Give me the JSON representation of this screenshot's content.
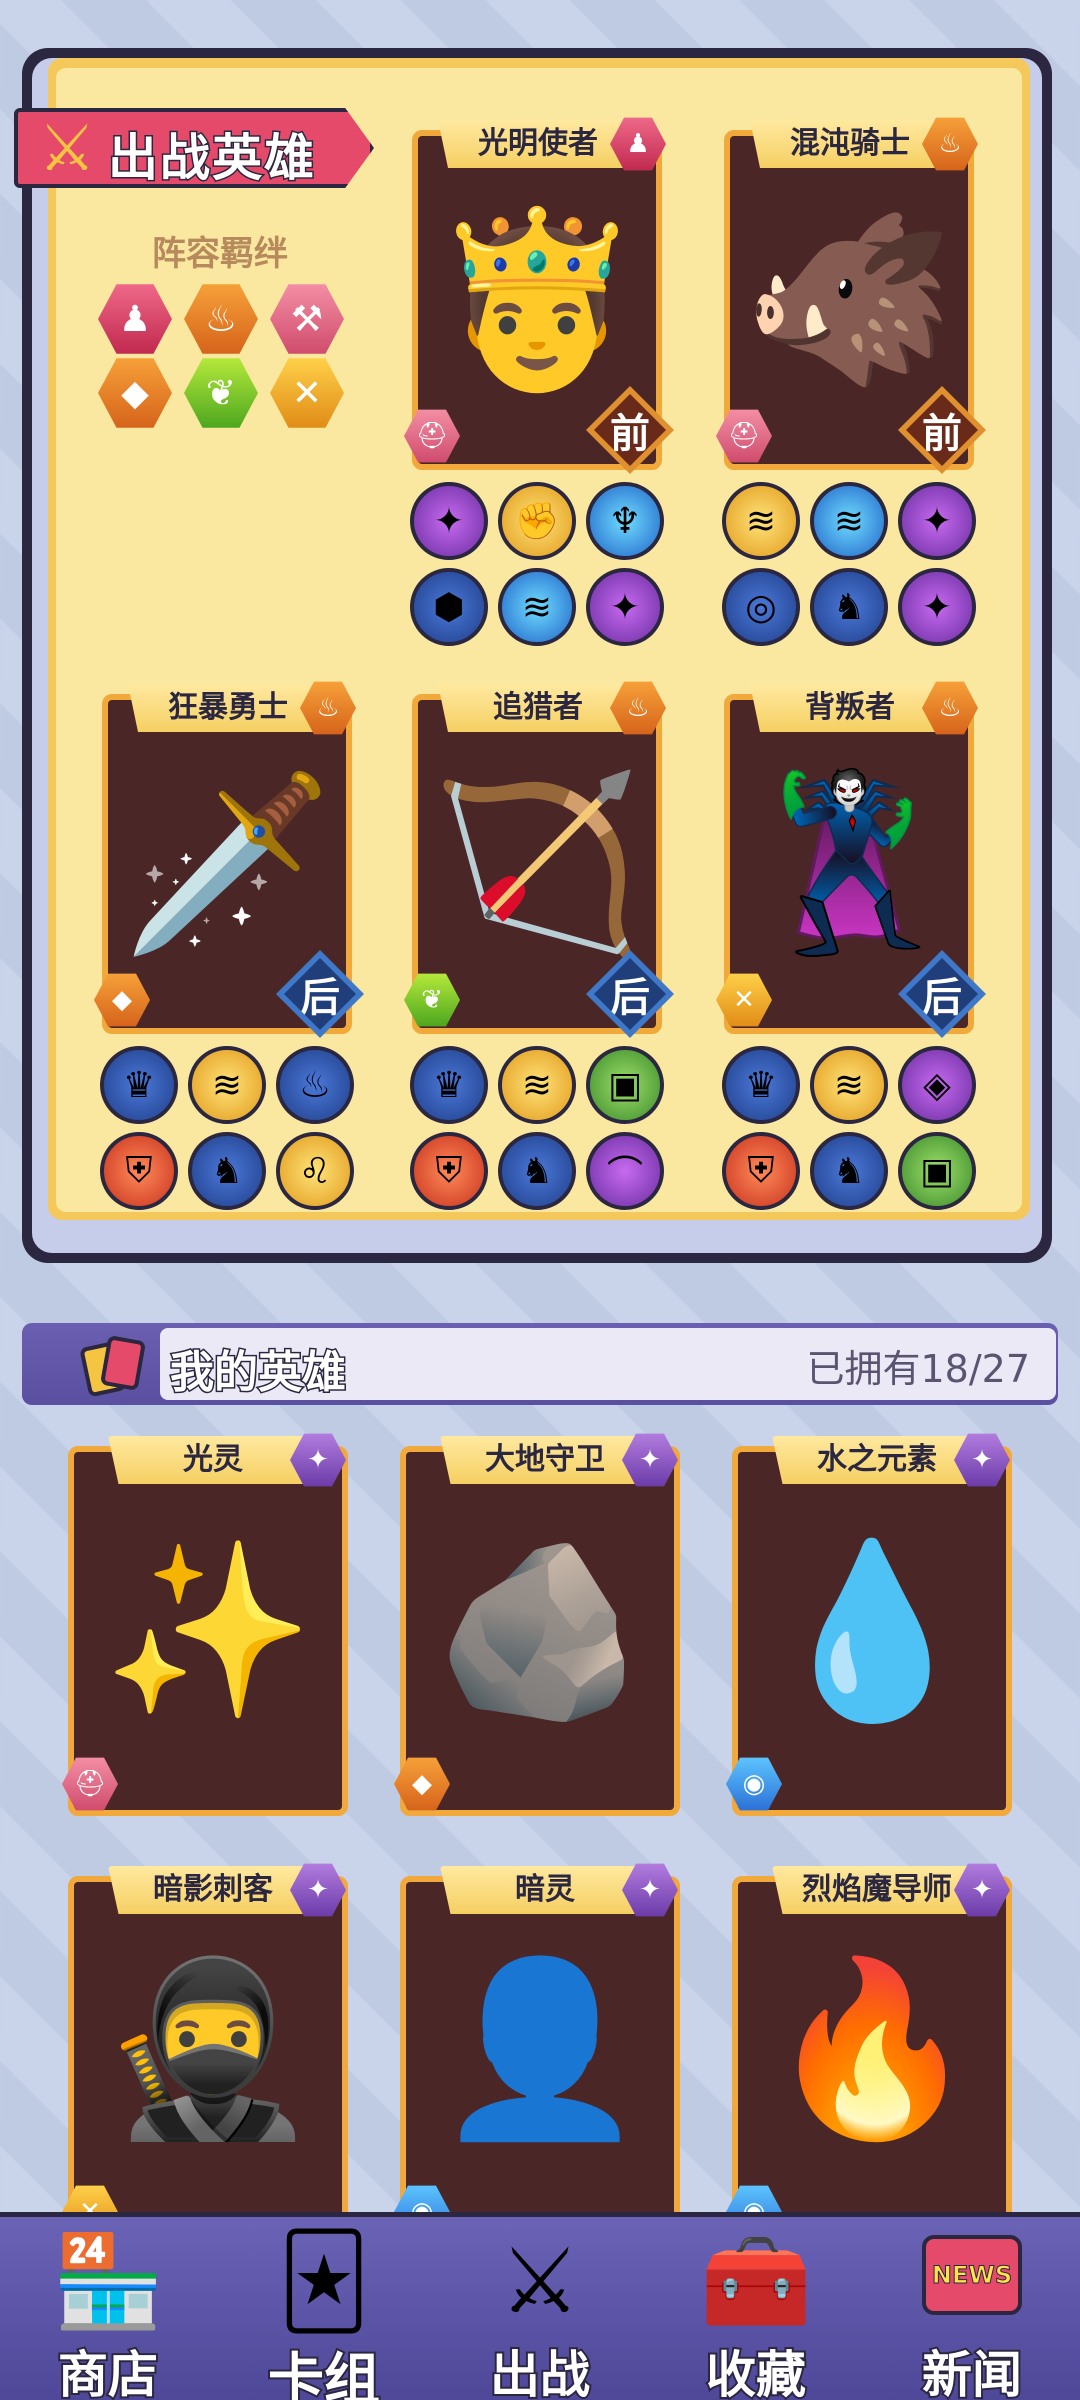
{
  "deploy": {
    "title": "出战英雄",
    "bond_label": "阵容羁绊",
    "bond_icons": [
      "hero-bond-red-icon",
      "flame-bond-icon",
      "axe-bond-icon",
      "crystal-bond-icon",
      "leaf-bond-icon",
      "blade-bond-icon"
    ],
    "heroes": [
      {
        "name": "光明使者",
        "position": "前",
        "class_icon": "person-icon",
        "race_icon": "helmet-icon",
        "art": "🤴",
        "skills": [
          "wings-icon",
          "gauntlet-icon",
          "totem-icon",
          "gem-icon",
          "dragon-icon",
          "wings-icon"
        ]
      },
      {
        "name": "混沌骑士",
        "position": "前",
        "class_icon": "flame-icon",
        "race_icon": "helmet-icon",
        "art": "🐗",
        "skills": [
          "claw-icon",
          "dragon-icon",
          "wings-icon",
          "stone-icon",
          "warrior-icon",
          "wings-icon"
        ]
      },
      {
        "name": "狂暴勇士",
        "position": "后",
        "class_icon": "flame-icon",
        "race_icon": "crystal-icon",
        "art": "🗡️",
        "skills": [
          "demon-icon",
          "claw-icon",
          "torch-icon",
          "shield-icon",
          "warrior-icon",
          "lion-icon"
        ]
      },
      {
        "name": "追猎者",
        "position": "后",
        "class_icon": "flame-icon",
        "race_icon": "leaf-icon",
        "art": "🏹",
        "skills": [
          "demon-icon",
          "claw-icon",
          "spellbook-icon",
          "shield-icon",
          "warrior-icon",
          "bow-icon"
        ]
      },
      {
        "name": "背叛者",
        "position": "后",
        "class_icon": "flame-icon",
        "race_icon": "blade-icon",
        "art": "🦹",
        "skills": [
          "demon-icon",
          "claw-icon",
          "void-icon",
          "shield-icon",
          "warrior-icon",
          "spellbook-icon"
        ]
      }
    ]
  },
  "my_heroes": {
    "title": "我的英雄",
    "owned": "已拥有18/27",
    "cards": [
      {
        "name": "光灵",
        "art": "✨",
        "race_icon": "helmet-icon"
      },
      {
        "name": "大地守卫",
        "art": "🪨",
        "race_icon": "crystal-icon"
      },
      {
        "name": "水之元素",
        "art": "💧",
        "race_icon": "water-icon"
      },
      {
        "name": "暗影刺客",
        "art": "🥷",
        "race_icon": "blade-icon"
      },
      {
        "name": "暗灵",
        "art": "👤",
        "race_icon": "water-icon"
      },
      {
        "name": "烈焰魔导师",
        "art": "🔥",
        "race_icon": "water-icon"
      }
    ]
  },
  "nav": {
    "shop": "商店",
    "deck": "卡组",
    "battle": "出战",
    "collection": "收藏",
    "news": "新闻",
    "news_badge": "NEWS"
  },
  "colors": {
    "accent": "#e64a6b",
    "card_border": "#f2a93b",
    "panel": "#fbe8a0",
    "nav": "#5a52a6"
  }
}
